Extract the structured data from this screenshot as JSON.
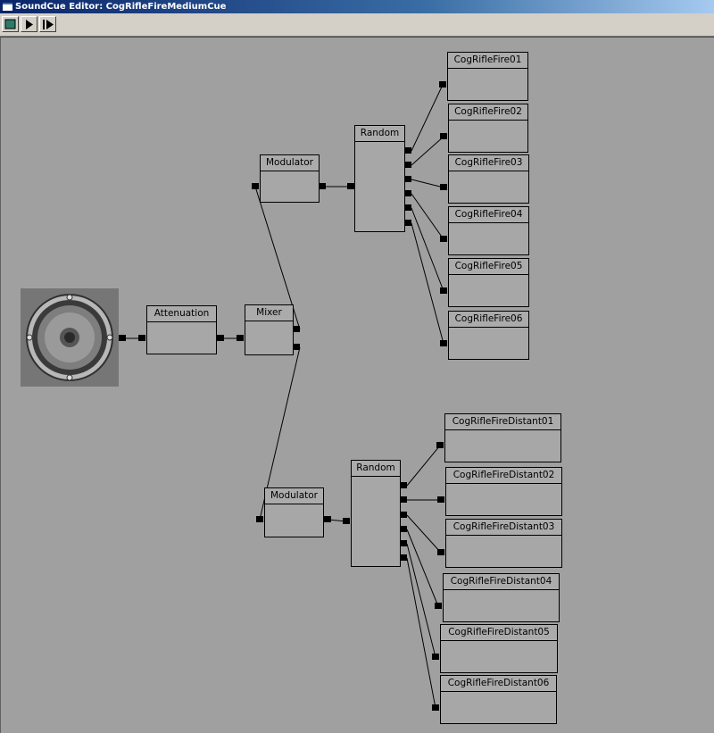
{
  "window": {
    "title": "SoundCue Editor: CogRifleFireMediumCue"
  },
  "toolbar": {
    "buttons": [
      {
        "name": "stop-icon",
        "tooltip": ""
      },
      {
        "name": "play-icon",
        "tooltip": ""
      },
      {
        "name": "play-node-icon",
        "tooltip": ""
      }
    ]
  },
  "graph": {
    "output": {
      "icon": "speaker-icon"
    },
    "attenuation": {
      "label": "Attenuation"
    },
    "mixer": {
      "label": "Mixer"
    },
    "modulator_top": {
      "label": "Modulator"
    },
    "modulator_bottom": {
      "label": "Modulator"
    },
    "random_top": {
      "label": "Random"
    },
    "random_bottom": {
      "label": "Random"
    },
    "waves_top": [
      "CogRifleFire01",
      "CogRifleFire02",
      "CogRifleFire03",
      "CogRifleFire04",
      "CogRifleFire05",
      "CogRifleFire06"
    ],
    "waves_bottom": [
      "CogRifleFireDistant01",
      "CogRifleFireDistant02",
      "CogRifleFireDistant03",
      "CogRifleFireDistant04",
      "CogRifleFireDistant05",
      "CogRifleFireDistant06"
    ]
  }
}
